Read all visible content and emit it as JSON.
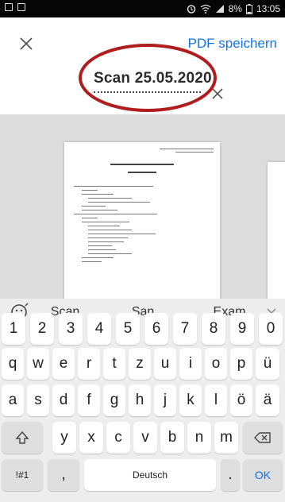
{
  "status_bar": {
    "battery": "8%",
    "time": "13:05"
  },
  "app_bar": {
    "save_label": "PDF speichern"
  },
  "document": {
    "title": "Scan 25.05.2020"
  },
  "keyboard": {
    "suggestions": [
      "Scan",
      "San",
      "Exam"
    ],
    "row_numbers": [
      "1",
      "2",
      "3",
      "4",
      "5",
      "6",
      "7",
      "8",
      "9",
      "0"
    ],
    "row1": [
      "q",
      "w",
      "e",
      "r",
      "t",
      "z",
      "u",
      "i",
      "o",
      "p",
      "ü"
    ],
    "row2": [
      "a",
      "s",
      "d",
      "f",
      "g",
      "h",
      "j",
      "k",
      "l",
      "ö",
      "ä"
    ],
    "row3": [
      "y",
      "x",
      "c",
      "v",
      "b",
      "n",
      "m"
    ],
    "symbols_label": "!#1",
    "comma_label": ",",
    "space_label": "Deutsch",
    "period_label": ".",
    "ok_label": "OK"
  },
  "colors": {
    "accent": "#1473e6",
    "annotation_red": "#b01d1d"
  }
}
